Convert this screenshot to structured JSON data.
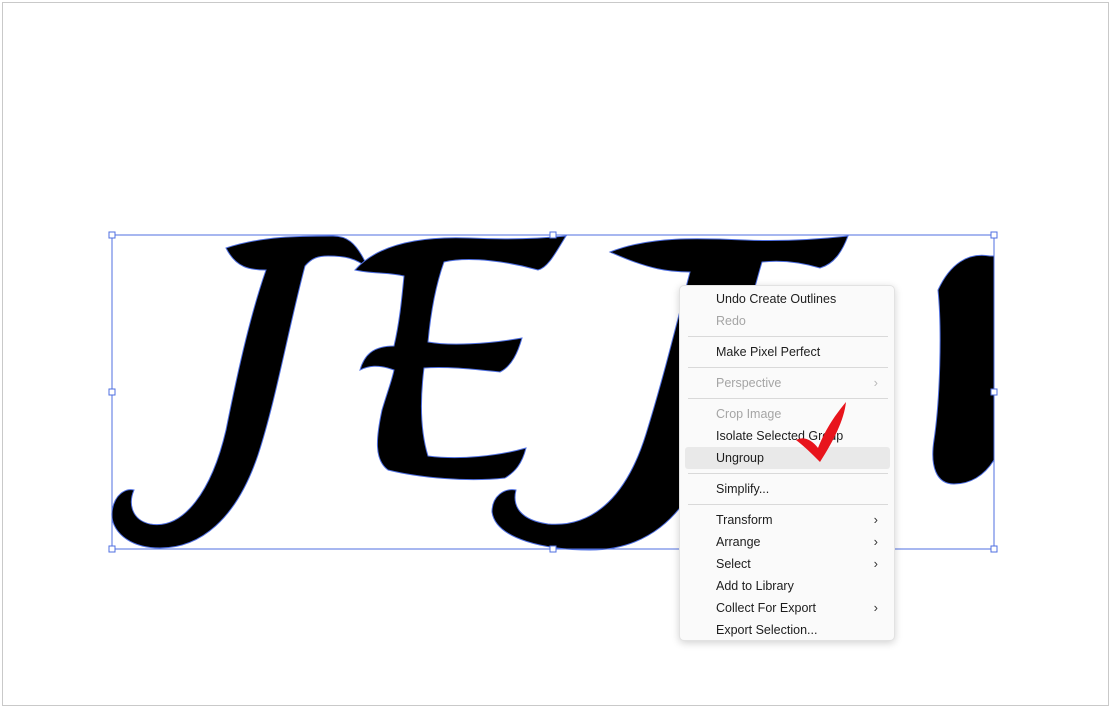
{
  "canvas": {
    "artwork_text": "JEJU",
    "selection_color": "#4f6fe0",
    "fill_color": "#000000"
  },
  "context_menu": {
    "items": [
      {
        "id": "undo-create-outlines",
        "label": "Undo Create Outlines",
        "enabled": true,
        "submenu": false
      },
      {
        "id": "redo",
        "label": "Redo",
        "enabled": false,
        "submenu": false
      },
      {
        "id": "make-pixel-perfect",
        "label": "Make Pixel Perfect",
        "enabled": true,
        "submenu": false
      },
      {
        "id": "perspective",
        "label": "Perspective",
        "enabled": false,
        "submenu": true
      },
      {
        "id": "crop-image",
        "label": "Crop Image",
        "enabled": false,
        "submenu": false
      },
      {
        "id": "isolate-selected-group",
        "label": "Isolate Selected Group",
        "enabled": true,
        "submenu": false
      },
      {
        "id": "ungroup",
        "label": "Ungroup",
        "enabled": true,
        "submenu": false,
        "highlighted": true
      },
      {
        "id": "simplify",
        "label": "Simplify...",
        "enabled": true,
        "submenu": false
      },
      {
        "id": "transform",
        "label": "Transform",
        "enabled": true,
        "submenu": true
      },
      {
        "id": "arrange",
        "label": "Arrange",
        "enabled": true,
        "submenu": true
      },
      {
        "id": "select",
        "label": "Select",
        "enabled": true,
        "submenu": true
      },
      {
        "id": "add-to-library",
        "label": "Add to Library",
        "enabled": true,
        "submenu": false
      },
      {
        "id": "collect-for-export",
        "label": "Collect For Export",
        "enabled": true,
        "submenu": true
      },
      {
        "id": "export-selection",
        "label": "Export Selection...",
        "enabled": true,
        "submenu": false
      }
    ],
    "submenu_glyph": "›"
  },
  "annotation": {
    "icon": "checkmark-icon",
    "color": "#e8141c"
  }
}
